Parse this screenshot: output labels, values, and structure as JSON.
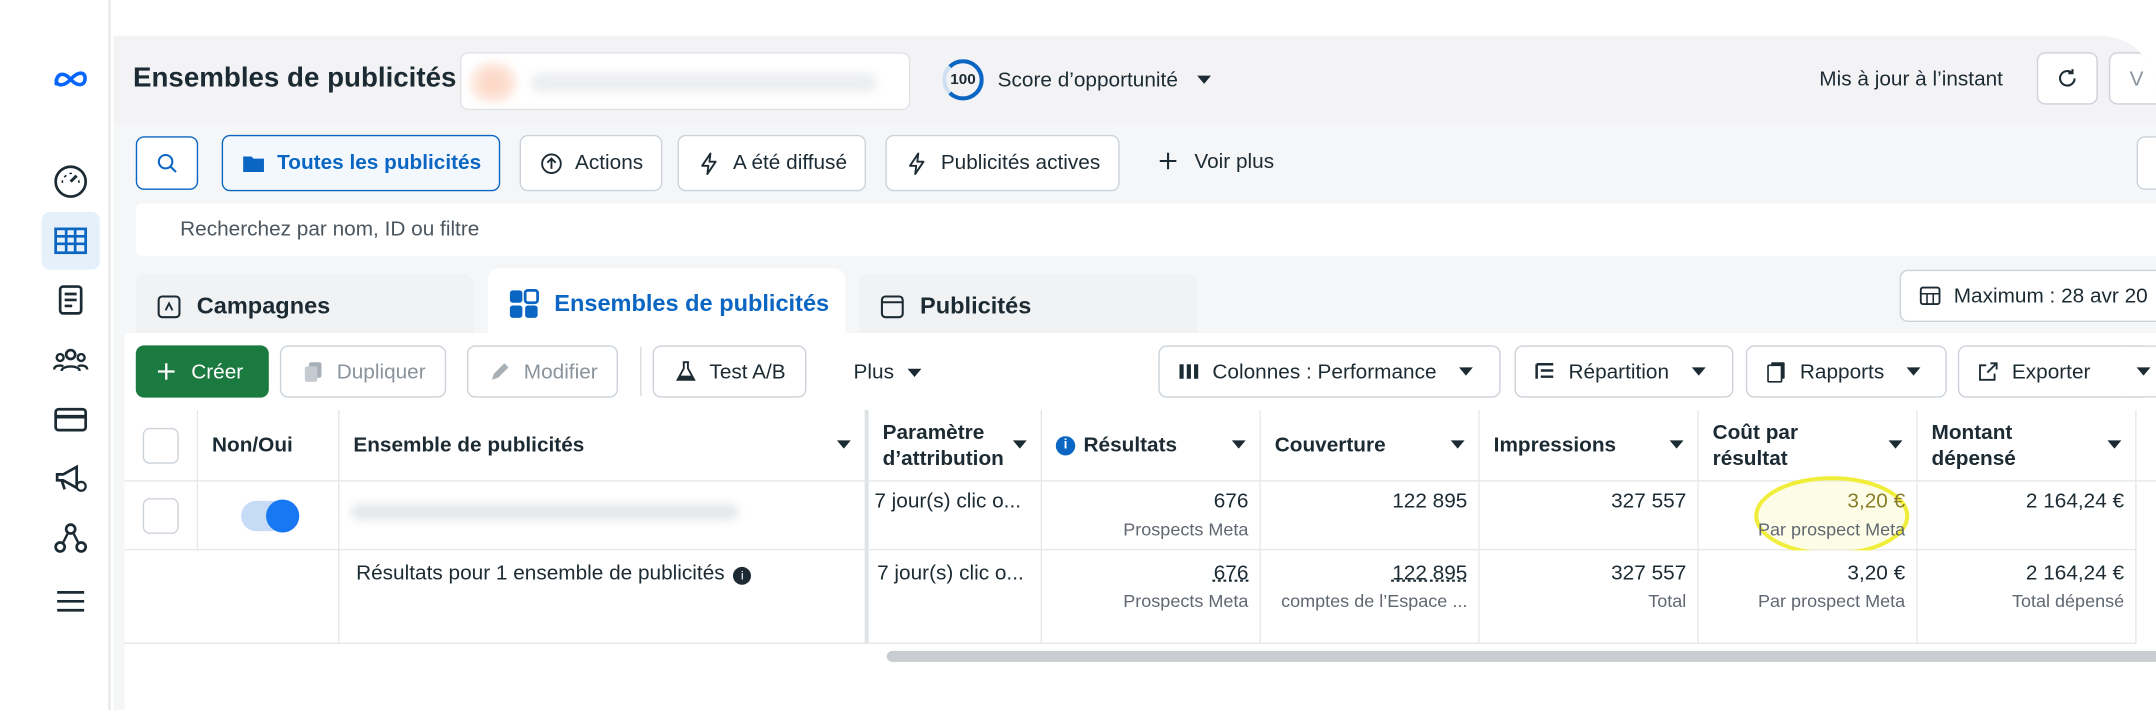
{
  "header": {
    "title": "Ensembles de publicités",
    "score_value": "100",
    "score_label": "Score d’opportunité",
    "updated": "Mis à jour à l’instant",
    "cut_button": "V"
  },
  "filters": {
    "all_ads": "Toutes les publicités",
    "actions": "Actions",
    "delivered": "A été diffusé",
    "active": "Publicités actives",
    "more": "Voir plus",
    "search_placeholder": "Recherchez par nom, ID ou filtre"
  },
  "tabs": {
    "campaigns": "Campagnes",
    "adsets": "Ensembles de publicités",
    "ads": "Publicités",
    "date": "Maximum : 28 avr 20"
  },
  "toolbar": {
    "create": "Créer",
    "duplicate": "Dupliquer",
    "edit": "Modifier",
    "abtest": "Test A/B",
    "plus": "Plus",
    "columns": "Colonnes : Performance",
    "breakdown": "Répartition",
    "reports": "Rapports",
    "export": "Exporter"
  },
  "table": {
    "headers": {
      "onoff": "Non/Oui",
      "adset": "Ensemble de publicités",
      "attribution": "Paramètre d’attribution",
      "results": "Résultats",
      "reach": "Couverture",
      "impressions": "Impressions",
      "cost": "Coût par résultat",
      "spent": "Montant dépensé"
    },
    "row": {
      "attribution": "7 jour(s) clic o...",
      "results": "676",
      "results_sub": "Prospects Meta",
      "reach": "122 895",
      "impressions": "327 557",
      "cost": "3,20 €",
      "cost_sub": "Par prospect Meta",
      "spent": "2 164,24 €"
    },
    "summary": {
      "label": "Résultats pour 1 ensemble de publicités",
      "attribution": "7 jour(s) clic o...",
      "results": "676",
      "results_sub": "Prospects Meta",
      "reach": "122 895",
      "reach_sub": "comptes de l’Espace ...",
      "impressions": "327 557",
      "impressions_sub": "Total",
      "cost": "3,20 €",
      "cost_sub": "Par prospect Meta",
      "spent": "2 164,24 €",
      "spent_sub": "Total dépensé"
    }
  },
  "colors": {
    "accent": "#0a66c2",
    "create": "#1b7a40",
    "highlight": "#f0ee3a",
    "toggle": "#1877f2"
  },
  "icons": [
    "meta-logo-icon",
    "dashboard-icon",
    "table-icon",
    "pages-icon",
    "people-icon",
    "card-icon",
    "megaphone-icon",
    "network-icon",
    "menu-icon",
    "search-icon",
    "folder-icon",
    "upload-icon",
    "bolt-icon",
    "plus-icon",
    "refresh-icon",
    "calendar-icon",
    "flask-icon",
    "columns-icon",
    "breakdown-icon",
    "reports-icon",
    "export-icon",
    "info-icon"
  ]
}
